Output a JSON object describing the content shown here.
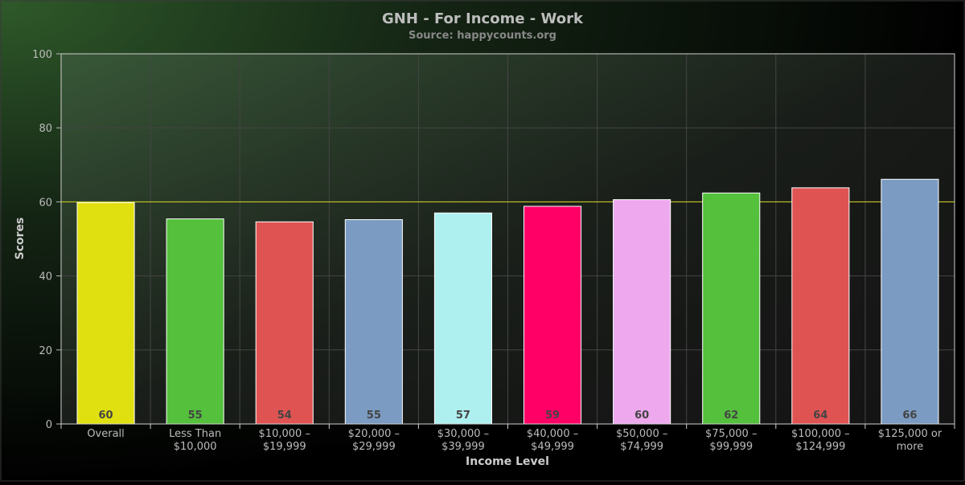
{
  "chart_data": {
    "type": "bar",
    "title": "GNH - For Income - Work",
    "subtitle": "Source: happycounts.org",
    "xlabel": "Income Level",
    "ylabel": "Scores",
    "ylim": [
      0,
      100
    ],
    "yticks": [
      0,
      20,
      40,
      60,
      80,
      100
    ],
    "grid": true,
    "reference_line": 60,
    "categories": [
      [
        "Overall"
      ],
      [
        "Less Than",
        "$10,000"
      ],
      [
        "$10,000 –",
        "$19,999"
      ],
      [
        "$20,000 –",
        "$29,999"
      ],
      [
        "$30,000 –",
        "$39,999"
      ],
      [
        "$40,000 –",
        "$49,999"
      ],
      [
        "$50,000 –",
        "$74,999"
      ],
      [
        "$75,000 –",
        "$99,999"
      ],
      [
        "$100,000 –",
        "$124,999"
      ],
      [
        "$125,000 or",
        "more"
      ]
    ],
    "values": [
      59.8,
      55.4,
      54.6,
      55.2,
      57.0,
      58.8,
      60.6,
      62.4,
      63.8,
      66.1
    ],
    "value_labels": [
      "60",
      "55",
      "54",
      "55",
      "57",
      "59",
      "60",
      "62",
      "64",
      "66"
    ],
    "colors": [
      "#e0e010",
      "#54c03c",
      "#e05353",
      "#7b9bc2",
      "#aef0ef",
      "#ff0066",
      "#eda8ee",
      "#54c03c",
      "#e05353",
      "#7b9bc2"
    ]
  }
}
